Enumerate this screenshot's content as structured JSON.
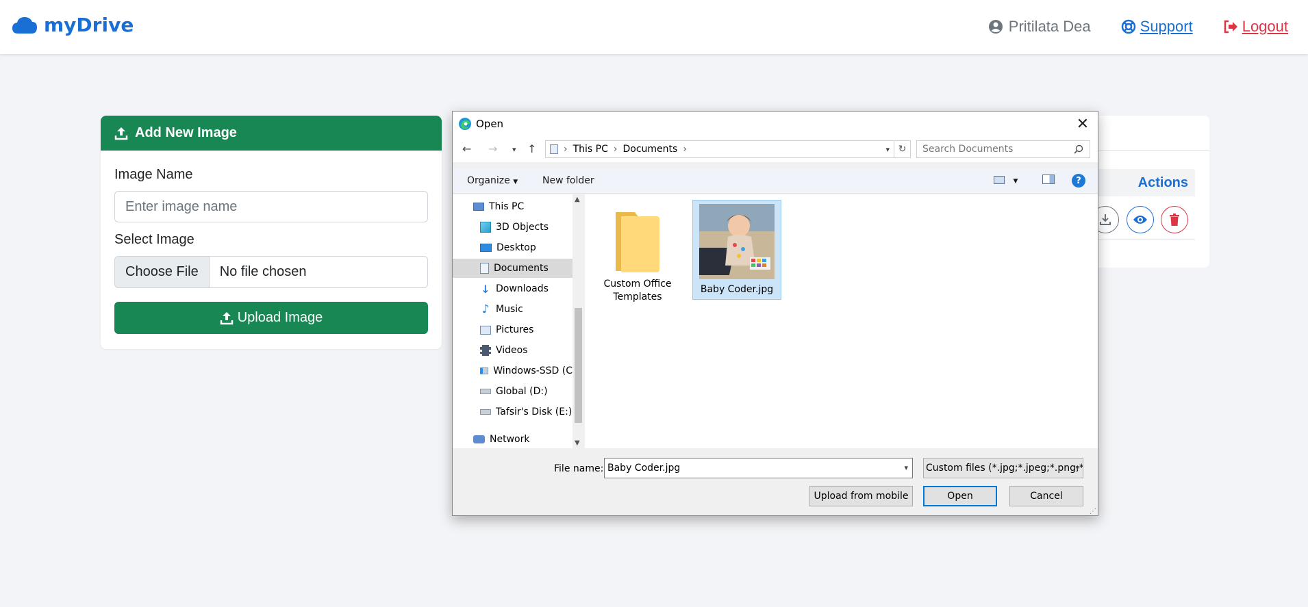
{
  "navbar": {
    "brand": "myDrive",
    "user": "Pritilata Dea",
    "support": "Support",
    "logout": "Logout"
  },
  "upload_card": {
    "title": "Add New Image",
    "name_label": "Image Name",
    "name_placeholder": "Enter image name",
    "select_label": "Select Image",
    "choose_file": "Choose File",
    "file_status": "No file chosen",
    "upload_button": "Upload Image"
  },
  "table_card": {
    "actions_header": "Actions"
  },
  "dialog": {
    "title": "Open",
    "breadcrumb": [
      "This PC",
      "Documents"
    ],
    "search_placeholder": "Search Documents",
    "toolbar": {
      "organize": "Organize",
      "new_folder": "New folder"
    },
    "nav_items": [
      {
        "label": "This PC",
        "icon": "computer-icon"
      },
      {
        "label": "3D Objects",
        "icon": "cube-icon"
      },
      {
        "label": "Desktop",
        "icon": "desktop-icon"
      },
      {
        "label": "Documents",
        "icon": "document-icon",
        "selected": true
      },
      {
        "label": "Downloads",
        "icon": "download-arrow-icon"
      },
      {
        "label": "Music",
        "icon": "music-note-icon"
      },
      {
        "label": "Pictures",
        "icon": "picture-icon"
      },
      {
        "label": "Videos",
        "icon": "film-icon"
      },
      {
        "label": "Windows-SSD (C",
        "icon": "drive-icon"
      },
      {
        "label": "Global (D:)",
        "icon": "drive-icon"
      },
      {
        "label": "Tafsir's Disk (E:)",
        "icon": "drive-icon"
      },
      {
        "label": "Network",
        "icon": "network-icon"
      }
    ],
    "files": [
      {
        "name_line1": "Custom Office",
        "name_line2": "Templates",
        "type": "folder"
      },
      {
        "name_line1": "Baby Coder.jpg",
        "type": "image",
        "selected": true
      }
    ],
    "file_name_label": "File name:",
    "file_name_value": "Baby Coder.jpg",
    "filter": "Custom files (*.jpg;*.jpeg;*.png;*",
    "upload_mobile": "Upload from mobile",
    "open": "Open",
    "cancel": "Cancel"
  },
  "colors": {
    "brand_blue": "#1a6fd4",
    "success_green": "#198754",
    "danger_red": "#dc3545"
  }
}
